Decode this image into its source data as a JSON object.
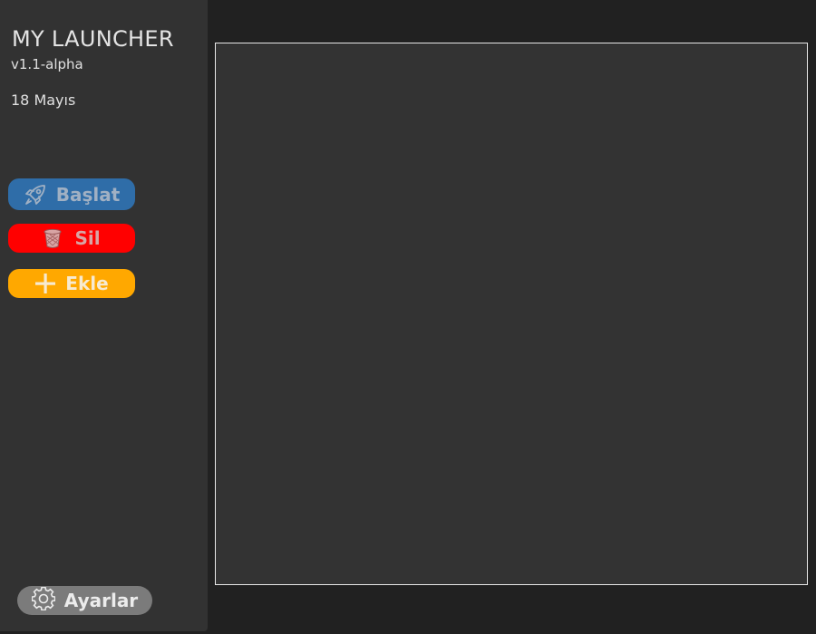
{
  "sidebar": {
    "title": "MY LAUNCHER",
    "version": "v1.1-alpha",
    "date": "18 Mayıs",
    "buttons": {
      "start": {
        "label": "Başlat",
        "icon": "rocket-icon",
        "color": "#2f6da8"
      },
      "delete": {
        "label": "Sil",
        "icon": "trash-icon",
        "color": "#ff0000"
      },
      "add": {
        "label": "Ekle",
        "icon": "plus-icon",
        "color": "#ffa800"
      }
    },
    "settings": {
      "label": "Ayarlar",
      "icon": "gear-icon",
      "color": "#7b7b7b"
    }
  },
  "theme": {
    "background": "#212121",
    "sidebar": "#323232",
    "panel": "#333333",
    "panel_border": "#e8e8e8"
  }
}
